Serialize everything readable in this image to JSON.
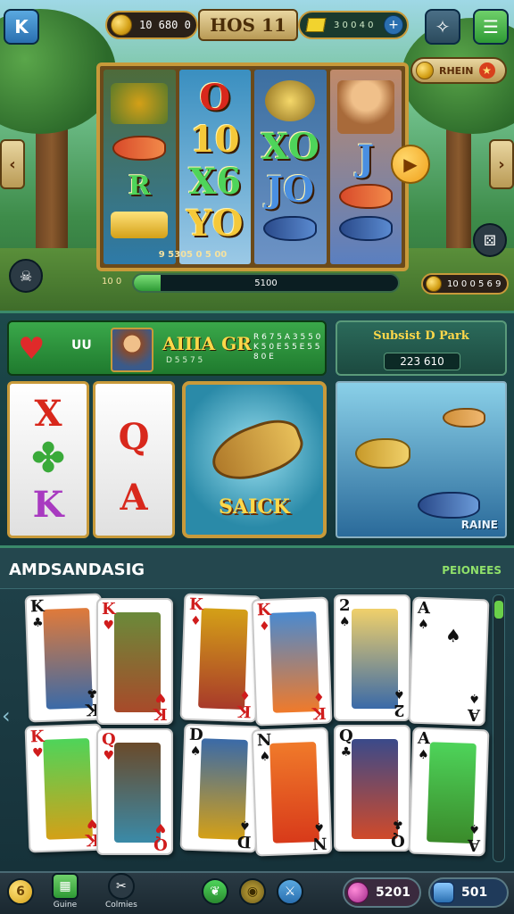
{
  "topbar": {
    "back_label": "K",
    "coins": "10 680 0",
    "title": "HOS 11",
    "gems": "3 0 0 4 0",
    "gem_plus": "+",
    "pin_icon": "✧",
    "menu_icon": "☰"
  },
  "bonus": {
    "label": "RHEIN"
  },
  "slot": {
    "reel1": [
      "",
      "",
      "",
      ""
    ],
    "reel2": [
      "O",
      "10",
      "X6",
      "YO"
    ],
    "reel3": [
      "",
      "XO",
      "JO",
      ""
    ],
    "reel4": [
      "",
      "J",
      "",
      ""
    ],
    "caption": "9 5305 0 5 00"
  },
  "progress": {
    "level": "10 0",
    "text": "5100",
    "fraction": 0.1
  },
  "balance": "10 0 0 5 6 9",
  "player": {
    "short": "UU",
    "name": "AIIIA GR",
    "sub": "D 5 5 7 5",
    "stat": "R 6 7 5 A 3 5 5 0 K 5 0 E 5 5 E 5 5 8 0 E"
  },
  "super": {
    "title": "Subsist D Park",
    "value": "223 610"
  },
  "mini_cards": {
    "a": [
      "X",
      "✤",
      "K"
    ],
    "b": [
      "Q",
      "A"
    ]
  },
  "fish_card_label": "SAICK",
  "ocean_label": "RAINE",
  "lower": {
    "title": "AMDSANDASIG",
    "right": "PEIONEES",
    "cards_row1": [
      {
        "rank": "K",
        "suit": "♣",
        "color": "k"
      },
      {
        "rank": "K",
        "suit": "♥",
        "color": "r"
      },
      {
        "rank": "K",
        "suit": "♦",
        "color": "r"
      },
      {
        "rank": "K",
        "suit": "♦",
        "color": "r"
      },
      {
        "rank": "2",
        "suit": "♠",
        "color": "k"
      },
      {
        "rank": "A",
        "suit": "♠",
        "color": "k"
      }
    ],
    "cards_row2": [
      {
        "rank": "K",
        "suit": "♥",
        "color": "r"
      },
      {
        "rank": "Q",
        "suit": "♥",
        "color": "r"
      },
      {
        "rank": "D",
        "suit": "♠",
        "color": "k"
      },
      {
        "rank": "N",
        "suit": "♠",
        "color": "k"
      },
      {
        "rank": "Q",
        "suit": "♣",
        "color": "k"
      },
      {
        "rank": "A",
        "suit": "♠",
        "color": "k"
      }
    ]
  },
  "bottombar": {
    "btn1_icon": "6",
    "games_label": "Guine",
    "columns_label": "Colmies",
    "chips_value": "5201",
    "gems_value": "501"
  }
}
